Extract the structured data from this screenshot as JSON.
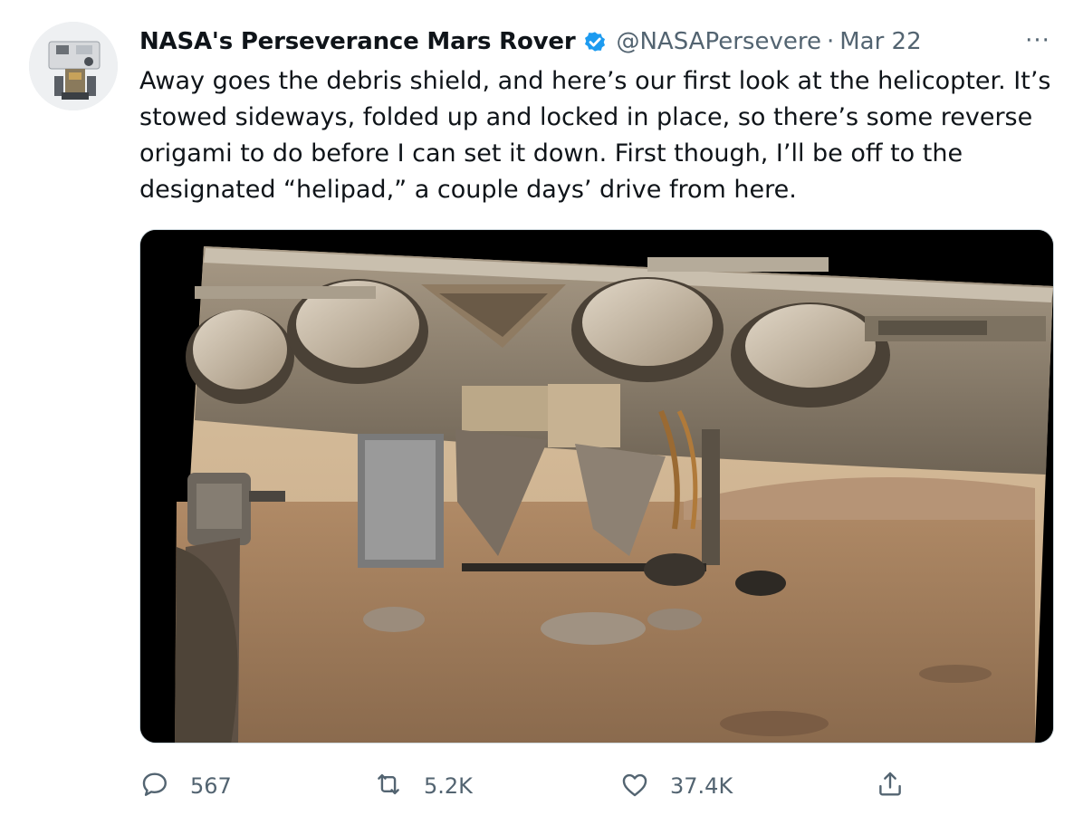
{
  "tweet": {
    "author_name": "NASA's Perseverance Mars Rover",
    "handle": "@NASAPersevere",
    "separator": "·",
    "date": "Mar 22",
    "more_label": "···",
    "text": "Away goes the debris shield, and here’s our first look at the helicopter. It’s\nstowed sideways, folded up and locked in place, so there’s some reverse\norigami to do before I can set it down. First though, I’ll be off to the\ndesignated “helipad,” a couple days’ drive from here.",
    "verified": true
  },
  "actions": {
    "reply_count": "567",
    "retweet_count": "5.2K",
    "like_count": "37.4K"
  },
  "icons": {
    "verified": "verified-badge-icon",
    "more": "more-icon",
    "reply": "reply-icon",
    "retweet": "retweet-icon",
    "like": "heart-icon",
    "share": "share-icon"
  },
  "colors": {
    "text": "#0f1419",
    "secondary": "#536471",
    "verified_blue": "#1d9bf0",
    "border": "#cfd9de"
  }
}
